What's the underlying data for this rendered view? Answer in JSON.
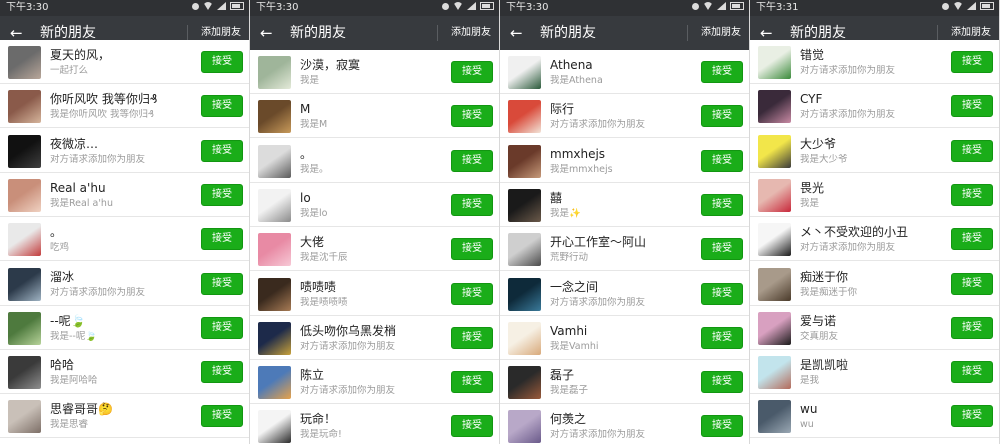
{
  "accept_label": "接受",
  "colors": {
    "accent": "#1aad19",
    "header": "#373a3e",
    "statusbar": "#2f3134"
  },
  "panels": [
    {
      "time": "下午3:30",
      "title": "新的朋友",
      "add_friend": "添加朋友",
      "rows": [
        {
          "name": "夏天的风，",
          "sub": "一起打么",
          "avatar": [
            "#6b6b6b",
            "#b9a79a"
          ]
        },
        {
          "name": "你听风吹 我等你归₰",
          "sub": "我是你听风吹 我等你归₰",
          "avatar": [
            "#8a5a4a",
            "#d6b59c"
          ]
        },
        {
          "name": "夜微凉…",
          "sub": "对方请求添加你为朋友",
          "avatar": [
            "#111111",
            "#3f3f3f"
          ]
        },
        {
          "name": "Real a'hu",
          "sub": "我是Real a'hu",
          "avatar": [
            "#c98f7a",
            "#f0d2c2"
          ]
        },
        {
          "name": "。",
          "sub": "吃鸡",
          "avatar": [
            "#e9e9e9",
            "#c23b3b"
          ]
        },
        {
          "name": "溜冰",
          "sub": "对方请求添加你为朋友",
          "avatar": [
            "#2c3a4a",
            "#9fb3c3"
          ]
        },
        {
          "name": "--呢🍃",
          "sub": "我是--呢🍃",
          "avatar": [
            "#4e7a3e",
            "#b7d39a"
          ]
        },
        {
          "name": "哈哈",
          "sub": "我是阿哈哈",
          "avatar": [
            "#3a3a3a",
            "#8f8f8f"
          ]
        },
        {
          "name": "思睿哥哥🤔",
          "sub": "我是思睿",
          "avatar": [
            "#c9c0b8",
            "#7d6f67"
          ]
        }
      ]
    },
    {
      "time": "下午3:30",
      "title": "新的朋友",
      "add_friend": "添加朋友",
      "rows": [
        {
          "name": "沙漠，寂寞",
          "sub": "我是",
          "avatar": [
            "#9fb59a",
            "#e4ead9"
          ]
        },
        {
          "name": "M",
          "sub": "我是M",
          "avatar": [
            "#6a4a2a",
            "#c89a5a"
          ]
        },
        {
          "name": "。",
          "sub": "我是。",
          "avatar": [
            "#dcdcdc",
            "#5a5a5a"
          ]
        },
        {
          "name": "lo",
          "sub": "我是lo",
          "avatar": [
            "#f2f2f2",
            "#8a8a8a"
          ]
        },
        {
          "name": "大佬",
          "sub": "我是沈千辰",
          "avatar": [
            "#e88aa4",
            "#f7c9d6"
          ]
        },
        {
          "name": "啧啧啧",
          "sub": "我是啧啧啧",
          "avatar": [
            "#3a2a1e",
            "#a77b55"
          ]
        },
        {
          "name": "低头吻你乌黑发梢",
          "sub": "对方请求添加你为朋友",
          "avatar": [
            "#1d2a4a",
            "#c9a23a"
          ]
        },
        {
          "name": "陈立",
          "sub": "对方请求添加你为朋友",
          "avatar": [
            "#4d7ab8",
            "#e7a24a"
          ]
        },
        {
          "name": "玩命！",
          "sub": "我是玩命!",
          "avatar": [
            "#f4f4f4",
            "#2a2a2a"
          ]
        }
      ]
    },
    {
      "time": "下午3:30",
      "title": "新的朋友",
      "add_friend": "添加朋友",
      "rows": [
        {
          "name": "Athena",
          "sub": "我是Athena",
          "avatar": [
            "#f0f0f0",
            "#2a5a3a"
          ]
        },
        {
          "name": "际行",
          "sub": "对方请求添加你为朋友",
          "avatar": [
            "#d94a3a",
            "#f2e4d8"
          ]
        },
        {
          "name": "mmxhejs",
          "sub": "我是mmxhejs",
          "avatar": [
            "#6a3a2a",
            "#c79a7a"
          ]
        },
        {
          "name": "囍",
          "sub": "我是✨",
          "avatar": [
            "#1a1a1a",
            "#6b5a4a"
          ]
        },
        {
          "name": "开心工作室～阿山",
          "sub": "荒野行动",
          "avatar": [
            "#cfcfcf",
            "#4a4a4a"
          ]
        },
        {
          "name": "一念之间",
          "sub": "对方请求添加你为朋友",
          "avatar": [
            "#0e2a3a",
            "#3a7a9a"
          ]
        },
        {
          "name": "Vamhi",
          "sub": "我是Vamhi",
          "avatar": [
            "#f6f0e4",
            "#d8a97a"
          ]
        },
        {
          "name": "磊子",
          "sub": "我是磊子",
          "avatar": [
            "#2a2a2a",
            "#9a5a3a"
          ]
        },
        {
          "name": "何羡之",
          "sub": "对方请求添加你为朋友",
          "avatar": [
            "#b8a8c8",
            "#6a5a8a"
          ]
        }
      ]
    },
    {
      "time": "下午3:31",
      "title": "新的朋友",
      "add_friend": "添加朋友",
      "rows": [
        {
          "name": "错觉",
          "sub": "对方请求添加你为朋友",
          "avatar": [
            "#e9efe4",
            "#3a8a3a"
          ]
        },
        {
          "name": "CYF",
          "sub": "对方请求添加你为朋友",
          "avatar": [
            "#3a2a3a",
            "#c98aa4"
          ]
        },
        {
          "name": "大少爷",
          "sub": "我是大少爷",
          "avatar": [
            "#f2e64a",
            "#3a3a3a"
          ]
        },
        {
          "name": "畏光",
          "sub": "我是",
          "avatar": [
            "#e6b8b0",
            "#c8283a"
          ]
        },
        {
          "name": "メ丶不受欢迎的小丑",
          "sub": "对方请求添加你为朋友",
          "avatar": [
            "#f6f6f6",
            "#1a1a1a"
          ]
        },
        {
          "name": "痴迷于你",
          "sub": "我是痴迷于你",
          "avatar": [
            "#a89a8a",
            "#4a3a2a"
          ]
        },
        {
          "name": "爱与诺",
          "sub": "交真朋友",
          "avatar": [
            "#d8a0c0",
            "#1a1a1a"
          ]
        },
        {
          "name": "是凯凯啦",
          "sub": "是我",
          "avatar": [
            "#c2e4ec",
            "#b46a5a"
          ]
        },
        {
          "name": "wu",
          "sub": "wu",
          "avatar": [
            "#4a5a6a",
            "#9aa8b4"
          ]
        }
      ]
    }
  ]
}
